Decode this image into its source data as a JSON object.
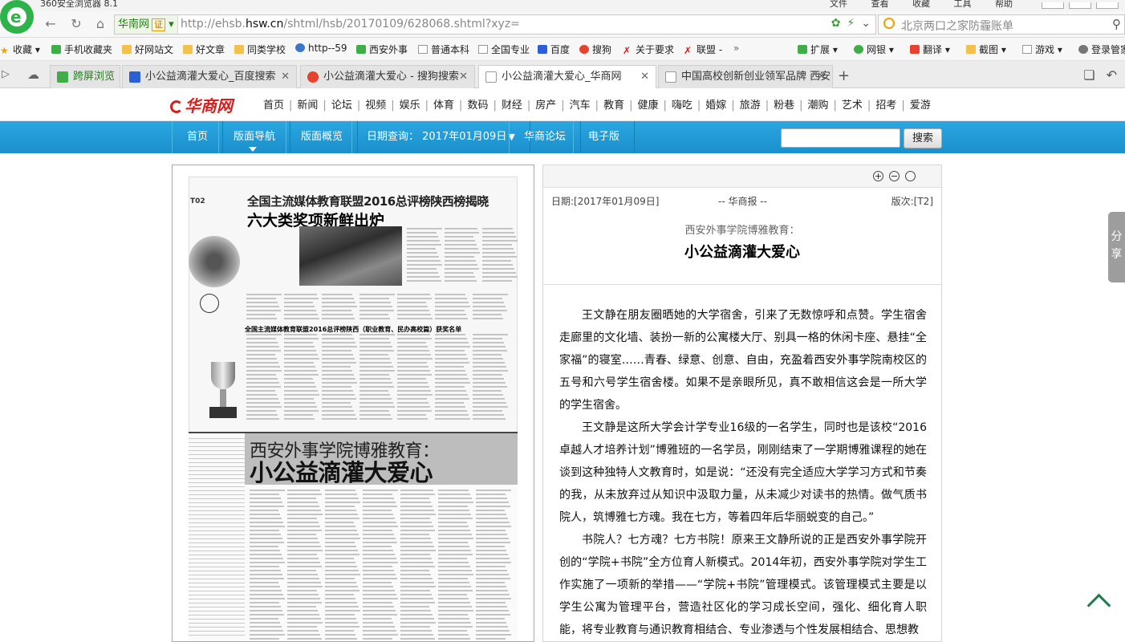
{
  "browser": {
    "window_title": "360安全浏览器 8.1",
    "menu": [
      "文件",
      "查看",
      "收藏",
      "工具",
      "帮助"
    ],
    "address": {
      "site_badge": "华南网",
      "verified": "证",
      "url_prefix": "http://ehsb.",
      "url_domain": "hsw.cn",
      "url_suffix": "/shtml/hsb/20170109/628068.shtml?xyz="
    },
    "search_placeholder": "北京两口之家防霾账单",
    "bookmarks": [
      {
        "label": "收藏",
        "icon": "star-icon"
      },
      {
        "label": "手机收藏夹",
        "icon": "phone-icon"
      },
      {
        "label": "好网站文",
        "icon": "folder-icon"
      },
      {
        "label": "好文章",
        "icon": "folder-icon"
      },
      {
        "label": "同类学校",
        "icon": "folder-icon"
      },
      {
        "label": "http--59",
        "icon": "globe-icon"
      },
      {
        "label": "西安外事",
        "icon": "gear-icon"
      },
      {
        "label": "普通本科",
        "icon": "page-icon"
      },
      {
        "label": "全国专业",
        "icon": "page-icon"
      },
      {
        "label": "百度",
        "icon": "baidu-icon"
      },
      {
        "label": "搜狗",
        "icon": "sogou-icon"
      },
      {
        "label": "关于要求",
        "icon": "lianmeng-icon"
      },
      {
        "label": "联盟 -",
        "icon": "lianmeng-icon"
      },
      {
        "label": "扩展",
        "icon": "extension-icon"
      },
      {
        "label": "网银",
        "icon": "bank-icon"
      },
      {
        "label": "翻译",
        "icon": "translate-icon"
      },
      {
        "label": "截图",
        "icon": "screenshot-icon"
      },
      {
        "label": "游戏",
        "icon": "game-icon"
      },
      {
        "label": "登录管家",
        "icon": "login-icon"
      }
    ],
    "tabs": [
      {
        "label": "跨屏浏览",
        "active": false
      },
      {
        "label": "小公益滴灌大爱心_百度搜索",
        "active": false
      },
      {
        "label": "小公益滴灌大爱心 - 搜狗搜索",
        "active": false
      },
      {
        "label": "小公益滴灌大爱心_华商网",
        "active": true
      },
      {
        "label": "中国高校创新创业领军品牌 西安",
        "active": false
      }
    ]
  },
  "site": {
    "logo": "华商网",
    "nav": [
      "首页",
      "新闻",
      "论坛",
      "视频",
      "娱乐",
      "体育",
      "数码",
      "财经",
      "房产",
      "汽车",
      "教育",
      "健康",
      "嗨吃",
      "婚嫁",
      "旅游",
      "粉巷",
      "潮购",
      "艺术",
      "招考",
      "爱游"
    ],
    "blue_nav": {
      "items": [
        "首页",
        "版面导航",
        "版面概览"
      ],
      "date_label": "日期查询：",
      "date_value": "2017年01月09日",
      "forum": "华商论坛",
      "epaper": "电子版",
      "search_button": "搜索"
    }
  },
  "newspaper_scan": {
    "page_label": "T02",
    "headline_top": "全国主流媒体教育联盟2016总评榜陕西榜揭晓",
    "headline_big": "六大类奖项新鲜出炉",
    "list_title": "全国主流媒体教育联盟2016总评榜陕西（职业教育、民办高校篇）获奖名单",
    "feature_head_small": "西安外事学院博雅教育：",
    "feature_head_big": "小公益滴灌大爱心"
  },
  "article": {
    "date": "日期:[2017年01月09日]",
    "paper": "-- 华商报 --",
    "edition": "版次:[T2]",
    "subtitle": "西安外事学院博雅教育：",
    "title": "小公益滴灌大爱心",
    "paragraphs": [
      "王文静在朋友圈晒她的大学宿舍，引来了无数惊呼和点赞。学生宿舍走廊里的文化墙、装扮一新的公寓楼大厅、别具一格的休闲卡座、悬挂“全家福”的寝室……青春、绿意、创意、自由，充盈着西安外事学院南校区的五号和六号学生宿舍楼。如果不是亲眼所见，真不敢相信这会是一所大学的学生宿舍。",
      "王文静是这所大学会计学专业16级的一名学生，同时也是该校“2016卓越人才培养计划”博雅班的一名学员，刚刚结束了一学期博雅课程的她在谈到这种独特人文教育时，如是说：“还没有完全适应大学学习方式和节奏的我，从未放弃过从知识中汲取力量，从未减少对读书的热情。做气质书院人，筑博雅七方魂。我在七方，等着四年后华丽蜕变的自己。”",
      "书院人？七方魂？七方书院！原来王文静所说的正是西安外事学院开创的“学院+书院”全方位育人新模式。2014年初，西安外事学院对学生工作实施了一项新的举措——“学院+书院”管理模式。该管理模式主要是以学生公寓为管理平台，营造社区化的学习成长空间，强化、细化育人职能，将专业教育与通识教育相结合、专业渗透与个性发展相结合、思想教"
    ]
  },
  "floating": {
    "share_label": "分享"
  }
}
